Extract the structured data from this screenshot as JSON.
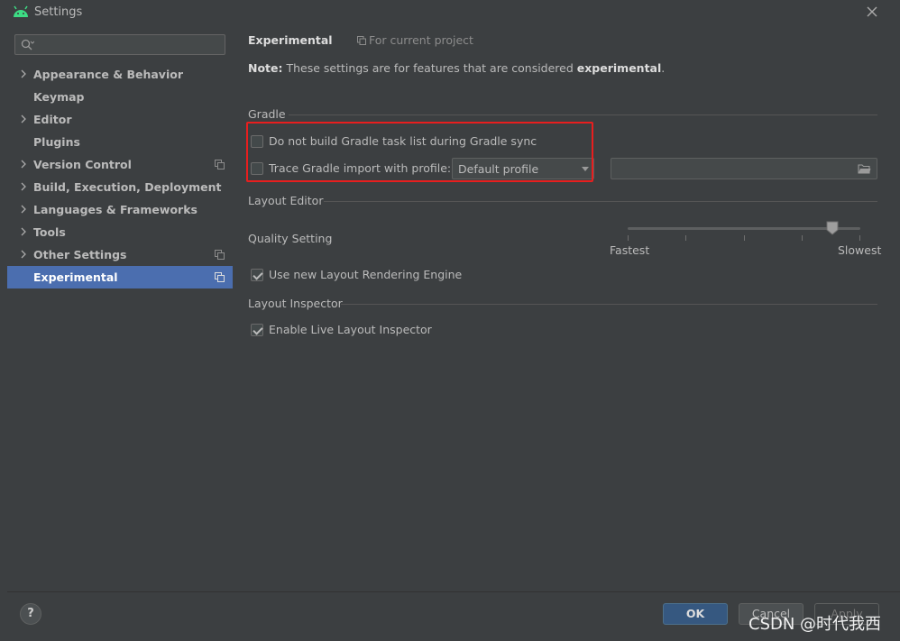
{
  "window": {
    "title": "Settings"
  },
  "search": {
    "placeholder": "",
    "value": ""
  },
  "sidebar": {
    "items": [
      {
        "label": "Appearance & Behavior",
        "expandable": true,
        "project": false,
        "selected": false
      },
      {
        "label": "Keymap",
        "expandable": false,
        "project": false,
        "selected": false
      },
      {
        "label": "Editor",
        "expandable": true,
        "project": false,
        "selected": false
      },
      {
        "label": "Plugins",
        "expandable": false,
        "project": false,
        "selected": false
      },
      {
        "label": "Version Control",
        "expandable": true,
        "project": true,
        "selected": false
      },
      {
        "label": "Build, Execution, Deployment",
        "expandable": true,
        "project": false,
        "selected": false
      },
      {
        "label": "Languages & Frameworks",
        "expandable": true,
        "project": false,
        "selected": false
      },
      {
        "label": "Tools",
        "expandable": true,
        "project": false,
        "selected": false
      },
      {
        "label": "Other Settings",
        "expandable": true,
        "project": true,
        "selected": false
      },
      {
        "label": "Experimental",
        "expandable": false,
        "project": true,
        "selected": true
      }
    ]
  },
  "header": {
    "title": "Experimental",
    "for_project": "For current project"
  },
  "note": {
    "prefix": "Note:",
    "text": " These settings are for features that are considered ",
    "emphasis": "experimental",
    "suffix": "."
  },
  "gradle": {
    "title": "Gradle",
    "no_task_list": {
      "label": "Do not build Gradle task list during Gradle sync",
      "checked": false
    },
    "trace_import": {
      "label": "Trace Gradle import with profile:",
      "checked": false
    },
    "profile_select": {
      "value": "Default profile"
    },
    "profile_path": {
      "value": ""
    }
  },
  "layout_editor": {
    "title": "Layout Editor",
    "quality_label": "Quality Setting",
    "quality_min_label": "Fastest",
    "quality_max_label": "Slowest",
    "quality_value": 0.9,
    "quality_ticks": 5,
    "new_rendering_engine": {
      "label": "Use new Layout Rendering Engine",
      "checked": true
    }
  },
  "layout_inspector": {
    "title": "Layout Inspector",
    "live_inspector": {
      "label": "Enable Live Layout Inspector",
      "checked": true
    }
  },
  "footer": {
    "help_label": "?",
    "ok_label": "OK",
    "cancel_label": "Cancel",
    "apply_label": "Apply"
  },
  "watermark": "CSDN @时代我西",
  "colors": {
    "background": "#3c3f41",
    "selection": "#4b6eaf",
    "ok_button": "#365880",
    "highlight_box": "#e81e1e",
    "android_green": "#3ddc84"
  },
  "icons": {
    "app": "android-icon",
    "close": "close-icon",
    "search": "search-icon",
    "expand": "chevron-right-icon",
    "project": "project-copy-icon",
    "folder": "folder-open-icon"
  }
}
